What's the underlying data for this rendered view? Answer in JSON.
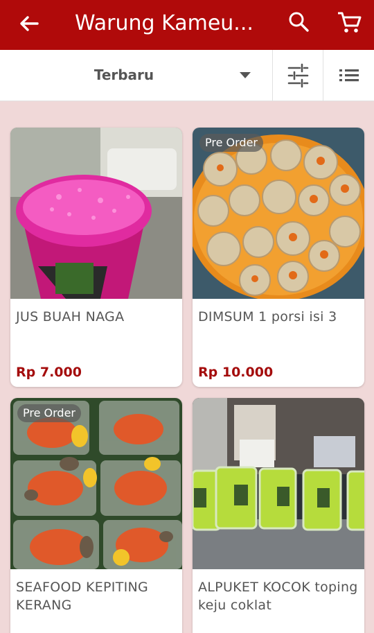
{
  "appbar": {
    "title": "Warung Kameu...",
    "icons": [
      "arrow-back-icon",
      "search-icon",
      "cart-icon"
    ]
  },
  "toolbar": {
    "sort_label": "Terbaru",
    "icons": [
      "chevron-down-icon",
      "tune-icon",
      "list-view-icon"
    ]
  },
  "products": [
    {
      "name": "JUS BUAH NAGA",
      "price": "Rp 7.000",
      "badge": ""
    },
    {
      "name": "DIMSUM 1 porsi isi 3",
      "price": "Rp 10.000",
      "badge": "Pre Order"
    },
    {
      "name": "SEAFOOD KEPITING KERANG",
      "price": "",
      "badge": "Pre Order"
    },
    {
      "name": "ALPUKET KOCOK toping keju coklat",
      "price": "",
      "badge": ""
    }
  ],
  "colors": {
    "primary": "#b00a0a",
    "background": "#f0d8d8",
    "price": "#a40c0c"
  }
}
